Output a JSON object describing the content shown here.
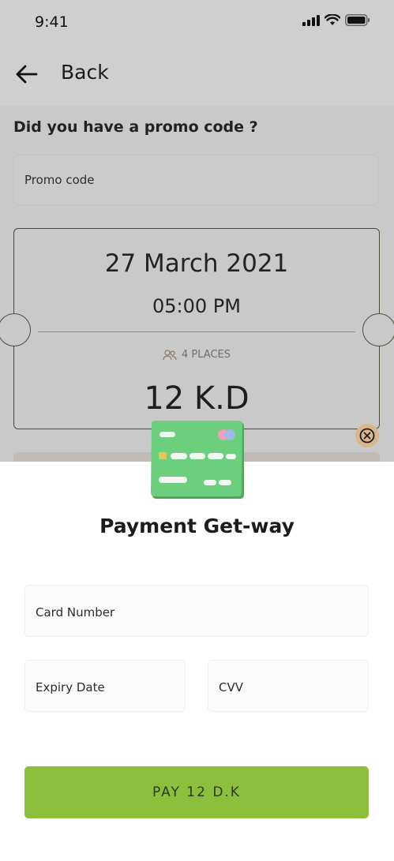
{
  "status_bar": {
    "time": "9:41"
  },
  "header": {
    "back_label": "Back"
  },
  "promo": {
    "title": "Did you have a promo code ?",
    "placeholder": "Promo code"
  },
  "ticket": {
    "date": "27 March  2021",
    "time": "05:00 PM",
    "places": "4 PLACES",
    "price": "12 K.D"
  },
  "payment": {
    "title": "Payment Get-way",
    "card_number_placeholder": "Card Number",
    "expiry_placeholder": "Expiry Date",
    "cvv_placeholder": "CVV",
    "pay_label": "PAY 12 D.K"
  },
  "colors": {
    "accent": "#8bbf3c",
    "close_button": "#d9b78c",
    "ticket_border": "#44513a",
    "card_green": "#6ccf7d"
  },
  "icons": [
    "signal-icon",
    "wifi-icon",
    "battery-icon",
    "back-arrow-icon",
    "users-icon",
    "close-icon",
    "credit-card-icon"
  ]
}
